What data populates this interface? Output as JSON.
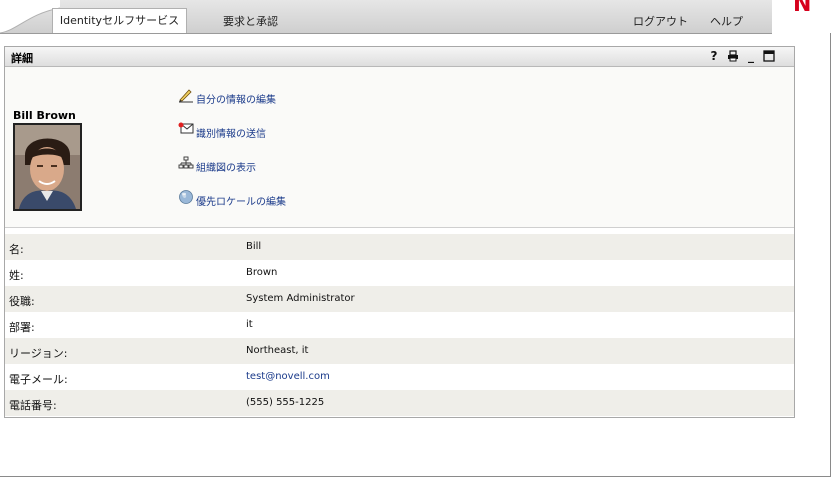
{
  "nav": {
    "tabs": [
      {
        "label": "Identityセルフサービス",
        "active": true
      },
      {
        "label": "要求と承認",
        "active": false
      }
    ],
    "links": {
      "logout": "ログアウト",
      "help": "ヘルプ"
    },
    "brand_letter": "N",
    "brand_color": "#d6001c"
  },
  "portlet": {
    "title": "詳細",
    "controls": {
      "help": "?",
      "print_icon": "printer-icon",
      "minimize": "_",
      "maximize_icon": "maximize-icon"
    }
  },
  "profile": {
    "name": "Bill Brown",
    "actions": [
      {
        "label": "自分の情報の編集",
        "icon": "pencil-icon"
      },
      {
        "label": "識別情報の送信",
        "icon": "envelope-icon"
      },
      {
        "label": "組織図の表示",
        "icon": "org-chart-icon"
      },
      {
        "label": "優先ロケールの編集",
        "icon": "globe-icon"
      }
    ]
  },
  "details": [
    {
      "label": "名:",
      "value": "Bill"
    },
    {
      "label": "姓:",
      "value": "Brown"
    },
    {
      "label": "役職:",
      "value": "System Administrator"
    },
    {
      "label": "部署:",
      "value": "it"
    },
    {
      "label": "リージョン:",
      "value": "Northeast, it"
    },
    {
      "label": "電子メール:",
      "value": "test@novell.com"
    },
    {
      "label": "電話番号:",
      "value": "(555) 555-1225"
    }
  ]
}
